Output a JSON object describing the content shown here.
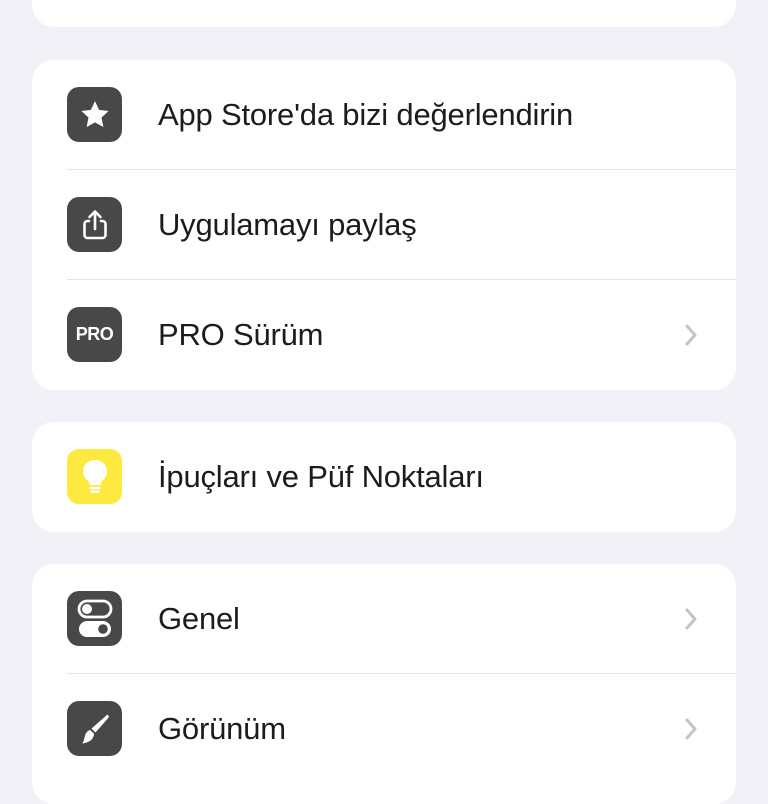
{
  "colors": {
    "background": "#f2f1f7",
    "card": "#ffffff",
    "icon_dark": "#484848",
    "icon_yellow": "#fde93f",
    "chevron": "#c3c3c8",
    "text": "#1c1c1e"
  },
  "group1": {
    "items": [
      {
        "label": "App Store'da bizi değerlendirin",
        "icon": "star-icon"
      },
      {
        "label": "Uygulamayı paylaş",
        "icon": "share-icon"
      },
      {
        "label": "PRO Sürüm",
        "icon": "pro-badge-icon",
        "icon_text": "PRO"
      }
    ]
  },
  "group2": {
    "items": [
      {
        "label": "İpuçları ve Püf Noktaları",
        "icon": "lightbulb-icon"
      }
    ]
  },
  "group3": {
    "items": [
      {
        "label": "Genel",
        "icon": "toggle-icon"
      },
      {
        "label": "Görünüm",
        "icon": "paintbrush-icon"
      }
    ]
  }
}
